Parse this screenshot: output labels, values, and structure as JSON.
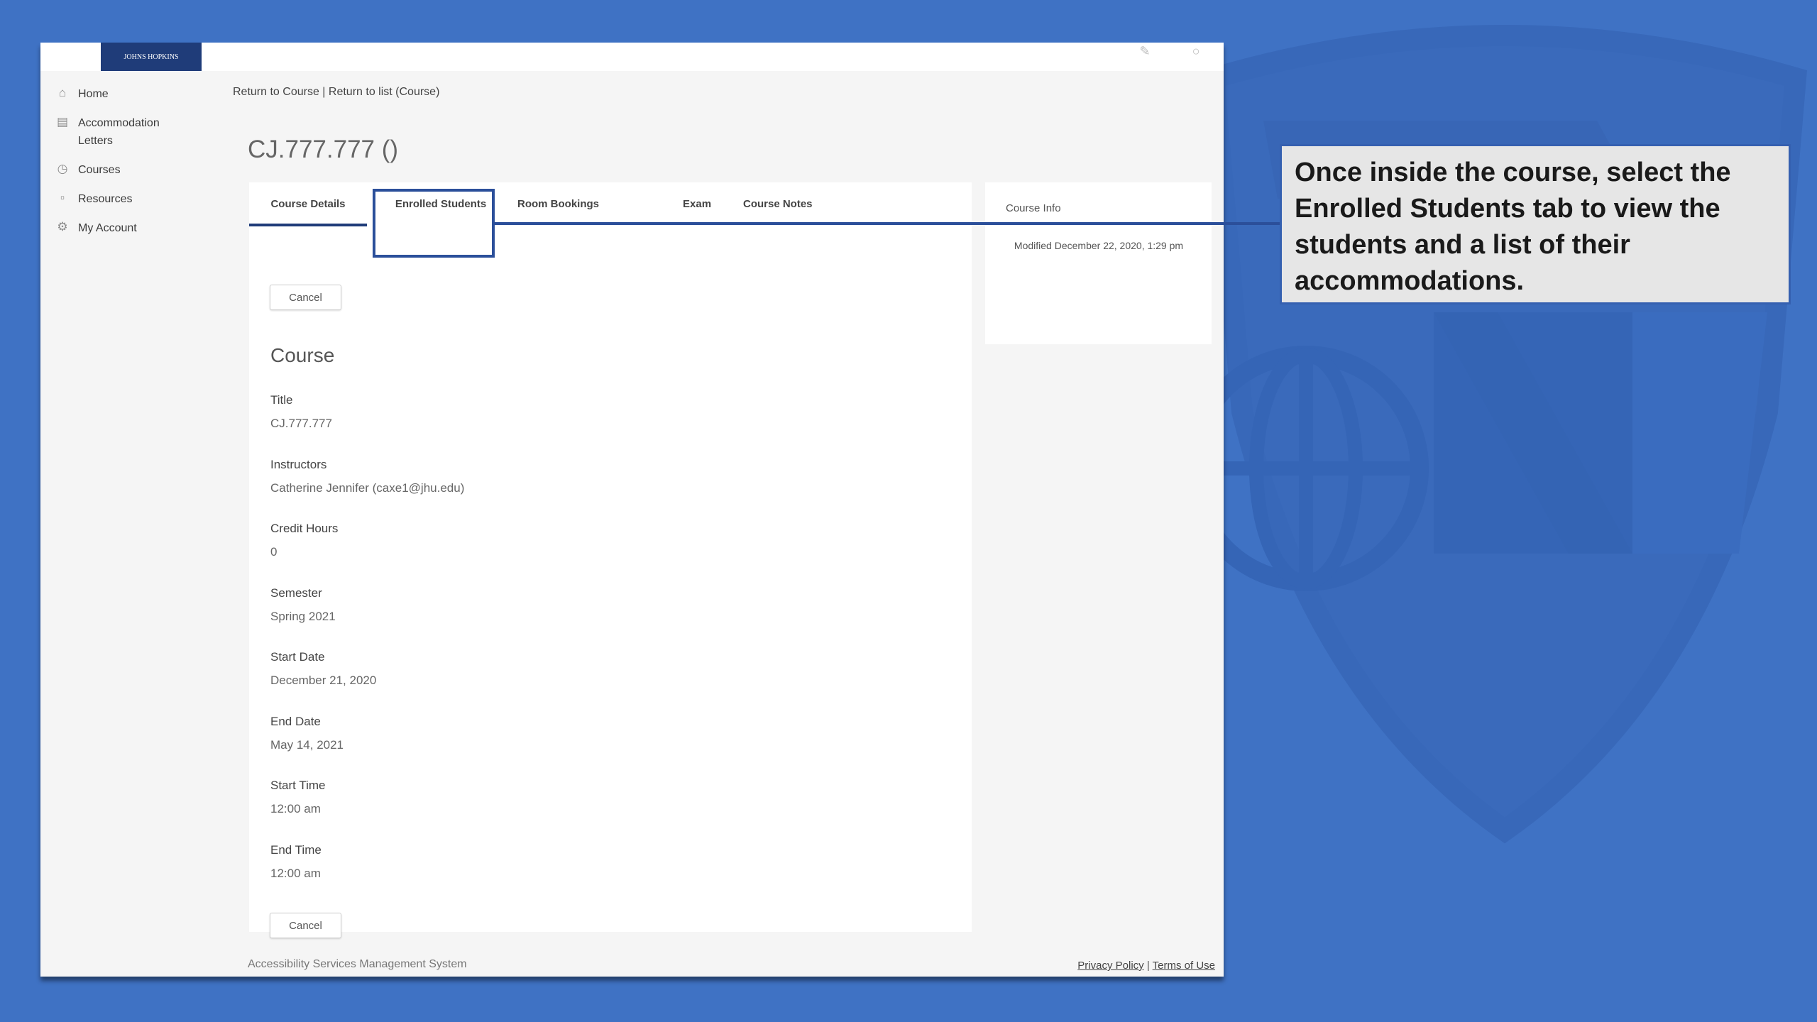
{
  "window": {
    "logo_text": "JOHNS HOPKINS"
  },
  "sidebar": {
    "items": [
      {
        "label": "Home",
        "icon": "home-icon"
      },
      {
        "label": "Accommodation Letters",
        "icon": "letter-icon"
      },
      {
        "label": "Courses",
        "icon": "courses-icon"
      },
      {
        "label": "Resources",
        "icon": "folder-icon"
      },
      {
        "label": "My Account",
        "icon": "gear-icon"
      }
    ]
  },
  "breadcrumb": {
    "return_to_course": "Return to Course",
    "separator": "|",
    "return_to_list": "Return to list (Course)"
  },
  "page_title": "CJ.777.777 ()",
  "tabs": [
    {
      "label": "Course Details",
      "active": true
    },
    {
      "label": "Enrolled Students",
      "active": false
    },
    {
      "label": "Room Bookings",
      "active": false
    },
    {
      "label": "Exam",
      "active": false
    },
    {
      "label": "Course Notes",
      "active": false
    }
  ],
  "buttons": {
    "cancel_label": "Cancel"
  },
  "course": {
    "heading": "Course",
    "fields": [
      {
        "label": "Title",
        "value": "CJ.777.777"
      },
      {
        "label": "Instructors",
        "value": "Catherine Jennifer (caxe1@jhu.edu)"
      },
      {
        "label": "Credit Hours",
        "value": "0"
      },
      {
        "label": "Semester",
        "value": "Spring 2021"
      },
      {
        "label": "Start Date",
        "value": "December 21, 2020"
      },
      {
        "label": "End Date",
        "value": "May 14, 2021"
      },
      {
        "label": "Start Time",
        "value": "12:00 am"
      },
      {
        "label": "End Time",
        "value": "12:00 am"
      }
    ]
  },
  "course_info": {
    "title": "Course Info",
    "modified": "Modified December 22, 2020, 1:29 pm"
  },
  "footer": {
    "system_name": "Accessibility Services Management System",
    "privacy_policy": "Privacy Policy",
    "separator": "|",
    "terms_of_use": "Terms of Use"
  },
  "callout": {
    "text": "Once inside the course, select the Enrolled Students tab to view the students and a list of their accommodations."
  },
  "colors": {
    "background": "#3f72c4",
    "nav_dark_blue": "#1f3c79",
    "highlight_blue": "#2b4f9a",
    "callout_bg": "#e6e6e6"
  }
}
